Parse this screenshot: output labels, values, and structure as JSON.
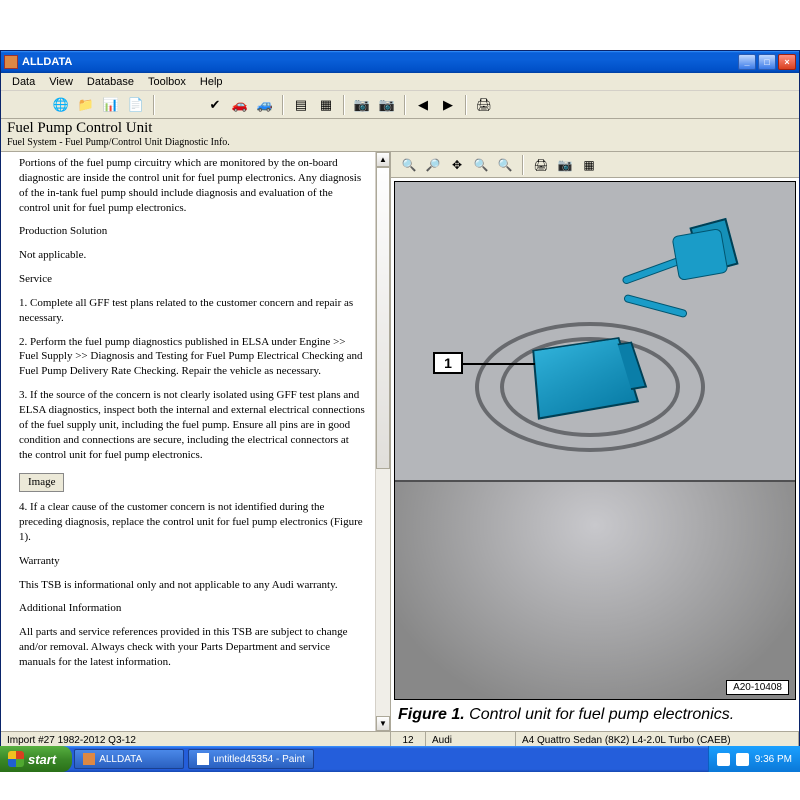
{
  "window": {
    "title": "ALLDATA",
    "min": "_",
    "max": "□",
    "close": "×"
  },
  "menubar": [
    "Data",
    "View",
    "Database",
    "Toolbox",
    "Help"
  ],
  "header": {
    "title": "Fuel Pump Control Unit",
    "subtitle": "Fuel System - Fuel Pump/Control Unit Diagnostic Info."
  },
  "article": {
    "intro": "Portions of the fuel pump circuitry which are monitored by the on-board diagnostic are inside the control unit for fuel pump electronics. Any diagnosis of the in-tank fuel pump should include diagnosis and evaluation of the control unit for fuel pump electronics.",
    "h_prod": "Production Solution",
    "prod": "Not applicable.",
    "h_service": "Service",
    "s1": "1. Complete all GFF test plans related to the customer concern and repair as necessary.",
    "s2": "2. Perform the fuel pump diagnostics published in ELSA under Engine >> Fuel Supply >> Diagnosis and Testing for Fuel Pump Electrical Checking and Fuel Pump Delivery Rate Checking. Repair the vehicle as necessary.",
    "s3": "3. If the source of the concern is not clearly isolated using GFF test plans and ELSA diagnostics, inspect both the internal and external electrical connections of the fuel supply unit, including the fuel pump. Ensure all pins are in good condition and connections are secure, including the electrical connectors at the control unit for fuel pump electronics.",
    "image_btn": "Image",
    "s4": "4. If a clear cause of the customer concern is not identified during the preceding diagnosis, replace the control unit for fuel pump electronics (Figure 1).",
    "h_warranty": "Warranty",
    "warranty": "This TSB is informational only and not applicable to any Audi warranty.",
    "h_addl": "Additional Information",
    "addl": "All parts and service references provided in this TSB are subject to change and/or removal. Always check with your Parts Department and service manuals for the latest information."
  },
  "diagram": {
    "callout": "1",
    "id": "A20-10408",
    "caption_label": "Figure 1.",
    "caption_text": " Control unit for fuel pump electronics."
  },
  "status": {
    "left": "Import #27 1982-2012 Q3-12",
    "page": "12",
    "make": "Audi",
    "model": "A4 Quattro Sedan (8K2)  L4-2.0L Turbo (CAEB)"
  },
  "taskbar": {
    "start": "start",
    "task1": "ALLDATA",
    "task2": "untitled45354 - Paint",
    "time": "9:36 PM"
  }
}
